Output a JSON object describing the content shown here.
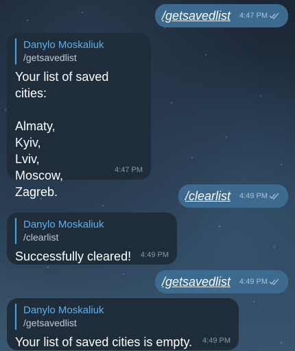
{
  "messages": {
    "m1": {
      "text": "/getsavedlist",
      "time": "4:47 PM"
    },
    "m2": {
      "reply_name": "Danylo Moskaliuk",
      "reply_text": "/getsavedlist",
      "line1": "Your list of saved cities:",
      "cities": [
        "Almaty,",
        "Kyiv,",
        "Lviv,",
        "Moscow,",
        "Zagreb."
      ],
      "time": "4:47 PM"
    },
    "m3": {
      "text": "/clearlist",
      "time": "4:49 PM"
    },
    "m4": {
      "reply_name": "Danylo Moskaliuk",
      "reply_text": "/clearlist",
      "body": "Successfully cleared!",
      "time": "4:49 PM"
    },
    "m5": {
      "text": "/getsavedlist",
      "time": "4:49 PM"
    },
    "m6": {
      "reply_name": "Danylo Moskaliuk",
      "reply_text": "/getsavedlist",
      "body": "Your list of saved cities is empty.",
      "time": "4:49 PM"
    }
  },
  "colors": {
    "outgoing_bubble": "#3d6a8f",
    "incoming_bubble": "#1f2c3a",
    "reply_accent": "#4fa3e0"
  },
  "icons": {
    "read_receipt": "double-check-icon"
  }
}
